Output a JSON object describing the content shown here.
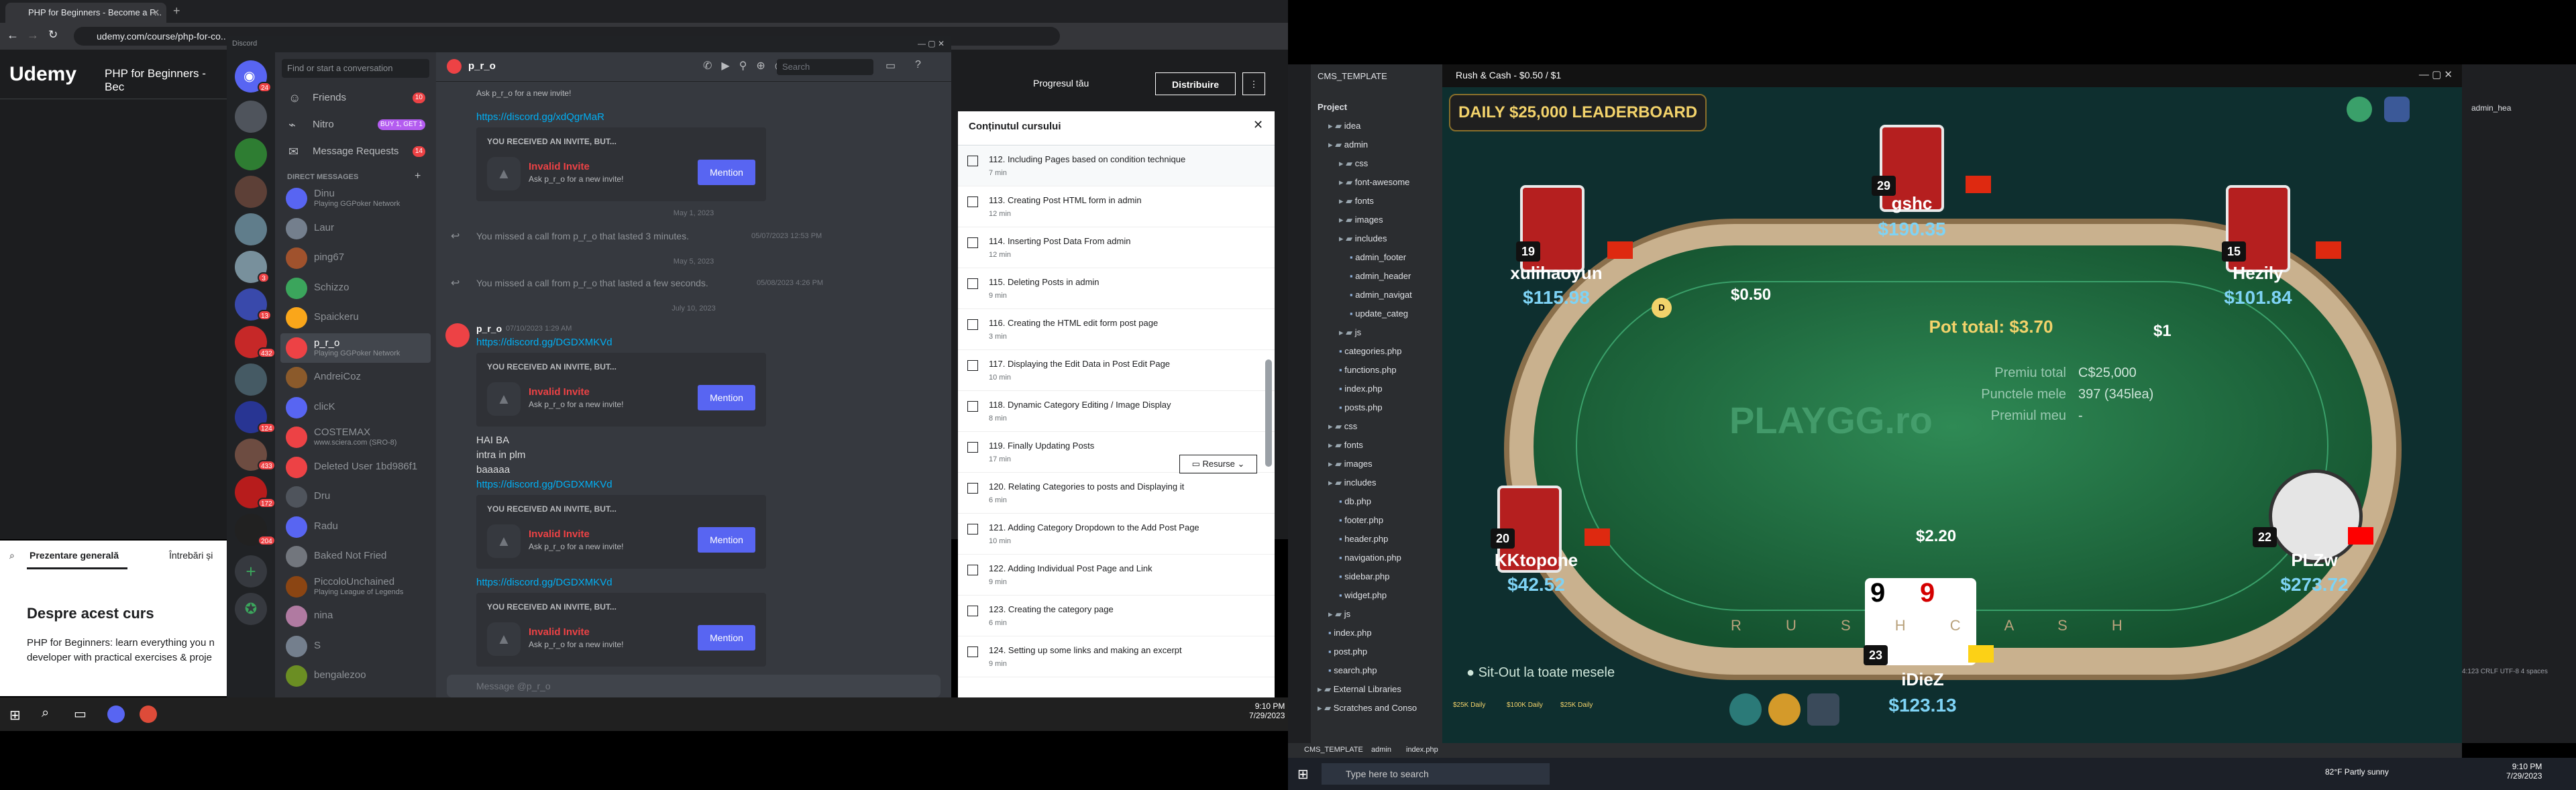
{
  "browser": {
    "tab_title": "PHP for Beginners - Become a P...",
    "url": "udemy.com/course/php-for-co...",
    "discord_window_label": "Discord"
  },
  "udemy": {
    "logo": "Udemy",
    "course_title": "PHP for Beginners - Bec",
    "progress_label": "Progresul tău",
    "share_label": "Distribuire",
    "tabs": [
      "Prezentare generală",
      "Întrebări și"
    ],
    "about_heading": "Despre acest curs",
    "about_text_1": "PHP for Beginners: learn everything you n",
    "about_text_2": "developer with practical exercises & proje"
  },
  "discord": {
    "home_badge": "24",
    "search_placeholder": "Find or start a conversation",
    "friends_label": "Friends",
    "friends_badge": "10",
    "nitro_label": "Nitro",
    "nitro_badge": "BUY 1, GET 1",
    "requests_label": "Message Requests",
    "requests_badge": "14",
    "direct_messages_label": "DIRECT MESSAGES",
    "dms": [
      {
        "name": "Dinu",
        "status": "Playing GGPoker Network",
        "color": "#5865f2"
      },
      {
        "name": "Laur",
        "status": "",
        "color": "#747f8d"
      },
      {
        "name": "ping67",
        "status": "",
        "color": "#a0522d"
      },
      {
        "name": "Schizzo",
        "status": "",
        "color": "#3ba55c"
      },
      {
        "name": "Spaickeru",
        "status": "",
        "color": "#faa61a"
      },
      {
        "name": "p_r_o",
        "status": "Playing GGPoker Network",
        "color": "#ed4245"
      },
      {
        "name": "AndreiCoz",
        "status": "",
        "color": "#8b5a2b"
      },
      {
        "name": "clicK",
        "status": "",
        "color": "#5865f2"
      },
      {
        "name": "COSTEMAX",
        "status": "www.sciera.com (SRO-8)",
        "color": "#ed4245"
      },
      {
        "name": "Deleted User 1bd986f1",
        "status": "",
        "color": "#ed4245"
      },
      {
        "name": "Dru",
        "status": "",
        "color": "#4f545c"
      },
      {
        "name": "Radu",
        "status": "",
        "color": "#5865f2"
      },
      {
        "name": "Baked Not Fried",
        "status": "",
        "color": "#72767d"
      },
      {
        "name": "PiccoloUnchained",
        "status": "Playing League of Legends",
        "color": "#8b4513"
      },
      {
        "name": "nina",
        "status": "",
        "color": "#b07aa1"
      },
      {
        "name": "S",
        "status": "",
        "color": "#747f8d"
      },
      {
        "name": "bengalezoo",
        "status": "",
        "color": "#6b8e23"
      }
    ],
    "chat": {
      "user": "p_r_o",
      "search_placeholder": "Search",
      "top_link": "https://discord.gg/xdQgrMaR",
      "invite_header": "YOU RECEIVED AN INVITE, BUT...",
      "invite_title": "Invalid Invite",
      "invite_sub": "Ask p_r_o for a new invite!",
      "mention_label": "Mention",
      "date_1": "May 1, 2023",
      "call_1_user": "p_r_o",
      "call_1_text": "You missed a call from p_r_o that lasted 3 minutes.",
      "call_1_time": "05/07/2023 12:53 PM",
      "date_2": "May 5, 2023",
      "call_2_text": "You missed a call from p_r_o that lasted a few seconds.",
      "call_2_time": "05/08/2023 4:26 PM",
      "date_3": "July 10, 2023",
      "msg_author": "p_r_o",
      "msg_time": "07/10/2023 1:29 AM",
      "msg_link": "https://discord.gg/DGDXMKVd",
      "text_1": "HAI BA",
      "text_2": "intra in plm",
      "text_3": "baaaaa",
      "composer_placeholder": "Message @p_r_o"
    },
    "other_badges": [
      "3",
      "13",
      "432",
      "124",
      "433",
      "172",
      "204"
    ]
  },
  "course_content": {
    "title": "Conținutul cursului",
    "resources_label": "Resurse",
    "lectures": [
      {
        "title": "112. Including Pages based on condition technique",
        "duration": "7 min"
      },
      {
        "title": "113. Creating Post HTML form in admin",
        "duration": "12 min"
      },
      {
        "title": "114. Inserting Post Data From admin",
        "duration": "12 min"
      },
      {
        "title": "115. Deleting Posts in admin",
        "duration": "9 min"
      },
      {
        "title": "116. Creating the HTML edit form post page",
        "duration": "3 min"
      },
      {
        "title": "117. Displaying the Edit Data in Post Edit Page",
        "duration": "10 min"
      },
      {
        "title": "118. Dynamic Category Editing / Image Display",
        "duration": "8 min"
      },
      {
        "title": "119. Finally Updating Posts",
        "duration": "17 min"
      },
      {
        "title": "120. Relating Categories to posts and Displaying it",
        "duration": "6 min"
      },
      {
        "title": "121. Adding Category Dropdown to the Add Post Page",
        "duration": "10 min"
      },
      {
        "title": "122. Adding Individual Post Page and Link",
        "duration": "9 min"
      },
      {
        "title": "123. Creating the category page",
        "duration": "6 min"
      },
      {
        "title": "124. Setting up some links and making an excerpt",
        "duration": "9 min"
      }
    ]
  },
  "taskbar_left": {
    "time": "9:10 PM",
    "date": "7/29/2023"
  },
  "ide": {
    "project_name": "CMS_TEMPLATE",
    "project_label": "Project",
    "tree": [
      {
        "label": "idea",
        "depth": 1,
        "type": "folder"
      },
      {
        "label": "admin",
        "depth": 1,
        "type": "folder"
      },
      {
        "label": "css",
        "depth": 2,
        "type": "folder"
      },
      {
        "label": "font-awesome",
        "depth": 2,
        "type": "folder"
      },
      {
        "label": "fonts",
        "depth": 2,
        "type": "folder"
      },
      {
        "label": "images",
        "depth": 2,
        "type": "folder"
      },
      {
        "label": "includes",
        "depth": 2,
        "type": "folder"
      },
      {
        "label": "admin_footer",
        "depth": 3,
        "type": "file"
      },
      {
        "label": "admin_header",
        "depth": 3,
        "type": "file"
      },
      {
        "label": "admin_navigat",
        "depth": 3,
        "type": "file"
      },
      {
        "label": "update_categ",
        "depth": 3,
        "type": "file"
      },
      {
        "label": "js",
        "depth": 2,
        "type": "folder"
      },
      {
        "label": "categories.php",
        "depth": 2,
        "type": "file"
      },
      {
        "label": "functions.php",
        "depth": 2,
        "type": "file"
      },
      {
        "label": "index.php",
        "depth": 2,
        "type": "file"
      },
      {
        "label": "posts.php",
        "depth": 2,
        "type": "file"
      },
      {
        "label": "css",
        "depth": 1,
        "type": "folder"
      },
      {
        "label": "fonts",
        "depth": 1,
        "type": "folder"
      },
      {
        "label": "images",
        "depth": 1,
        "type": "folder"
      },
      {
        "label": "includes",
        "depth": 1,
        "type": "folder"
      },
      {
        "label": "db.php",
        "depth": 2,
        "type": "file"
      },
      {
        "label": "footer.php",
        "depth": 2,
        "type": "file"
      },
      {
        "label": "header.php",
        "depth": 2,
        "type": "file"
      },
      {
        "label": "navigation.php",
        "depth": 2,
        "type": "file"
      },
      {
        "label": "sidebar.php",
        "depth": 2,
        "type": "file"
      },
      {
        "label": "widget.php",
        "depth": 2,
        "type": "file"
      },
      {
        "label": "js",
        "depth": 1,
        "type": "folder"
      },
      {
        "label": "index.php",
        "depth": 1,
        "type": "file"
      },
      {
        "label": "post.php",
        "depth": 1,
        "type": "file"
      },
      {
        "label": "search.php",
        "depth": 1,
        "type": "file"
      },
      {
        "label": "External Libraries",
        "depth": 0,
        "type": "folder"
      },
      {
        "label": "Scratches and Conso",
        "depth": 0,
        "type": "folder"
      }
    ],
    "breadcrumb": [
      "CMS_TEMPLATE",
      "admin",
      "index.php"
    ],
    "status_right": "4:123  CRLF  UTF-8  4 spaces",
    "admin_tab": "admin_hea"
  },
  "poker": {
    "window_title": "Rush & Cash - $0.50 / $1",
    "leaderboard": "DAILY $25,000 LEADERBOARD",
    "pot_total": "Pot total: $3.70",
    "info_labels": [
      "Premiu total",
      "Punctele mele",
      "Premiul meu"
    ],
    "info_values": [
      "C$25,000",
      "397 (345lea)",
      "-"
    ],
    "logo": "PLAYGG.ro",
    "sitout": "Sit-Out la toate mesele",
    "bets": [
      "$0.50",
      "$1",
      "$2.20"
    ],
    "seats": [
      {
        "name": "gshc",
        "stack": "$190.35",
        "level": "29"
      },
      {
        "name": "xulihaoyun",
        "stack": "$115.98",
        "level": "19"
      },
      {
        "name": "Hezily",
        "stack": "$101.84",
        "level": "15"
      },
      {
        "name": "KKtopone",
        "stack": "$42.52",
        "level": "20"
      },
      {
        "name": "PLZw",
        "stack": "$273.72",
        "level": "22"
      },
      {
        "name": "iDieZ",
        "stack": "$123.13",
        "level": "23"
      }
    ],
    "hero_cards": [
      "9",
      "9"
    ],
    "rail_letters": "R U S H   C A S H",
    "bottom_icons": [
      "$25K Daily",
      "$100K Daily",
      "$25K Daily"
    ]
  },
  "taskbar_right": {
    "search_placeholder": "Type here to search",
    "weather": "82°F  Partly sunny",
    "time": "9:10 PM",
    "date": "7/29/2023"
  }
}
